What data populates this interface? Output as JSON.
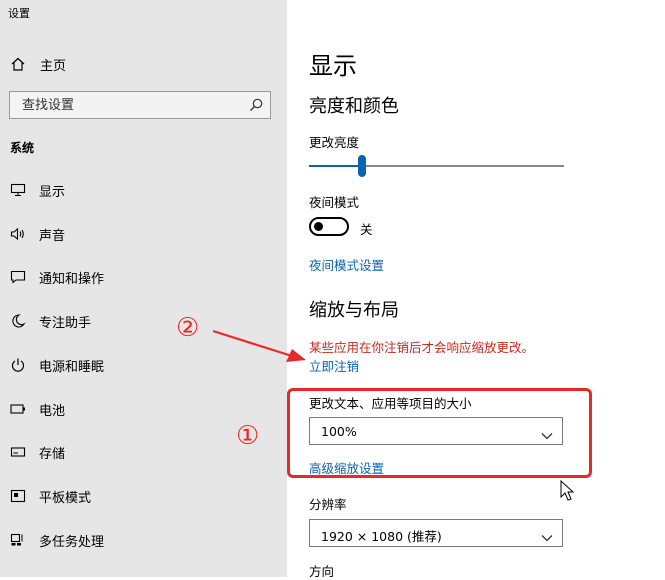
{
  "window": {
    "title": "设置"
  },
  "sidebar": {
    "home_label": "主页",
    "search_placeholder": "查找设置",
    "section_label": "系统",
    "items": [
      {
        "label": "显示",
        "icon": "monitor-icon"
      },
      {
        "label": "声音",
        "icon": "speaker-icon"
      },
      {
        "label": "通知和操作",
        "icon": "message-icon"
      },
      {
        "label": "专注助手",
        "icon": "moon-icon"
      },
      {
        "label": "电源和睡眠",
        "icon": "power-icon"
      },
      {
        "label": "电池",
        "icon": "battery-icon"
      },
      {
        "label": "存储",
        "icon": "storage-icon"
      },
      {
        "label": "平板模式",
        "icon": "tablet-icon"
      },
      {
        "label": "多任务处理",
        "icon": "multitask-icon"
      }
    ]
  },
  "main": {
    "title": "显示",
    "brightness_section": "亮度和颜色",
    "brightness_label": "更改亮度",
    "brightness_value": 0.2,
    "night_mode_label": "夜间模式",
    "night_mode_state": "关",
    "night_mode_link": "夜间模式设置",
    "scale_section": "缩放与布局",
    "scale_warning": "某些应用在你注销后才会响应缩放更改。",
    "signout_link": "立即注销",
    "text_size_label": "更改文本、应用等项目的大小",
    "text_size_value": "100%",
    "advanced_scaling_link": "高级缩放设置",
    "resolution_label": "分辨率",
    "resolution_value": "1920 × 1080 (推荐)",
    "orientation_label": "方向"
  },
  "annotations": {
    "marker_1": "①",
    "marker_2": "②",
    "color": "#e8292b"
  },
  "colors": {
    "accent": "#0c63b0",
    "warning": "#c42b1c",
    "sidebar_bg": "#e6e6e6"
  }
}
